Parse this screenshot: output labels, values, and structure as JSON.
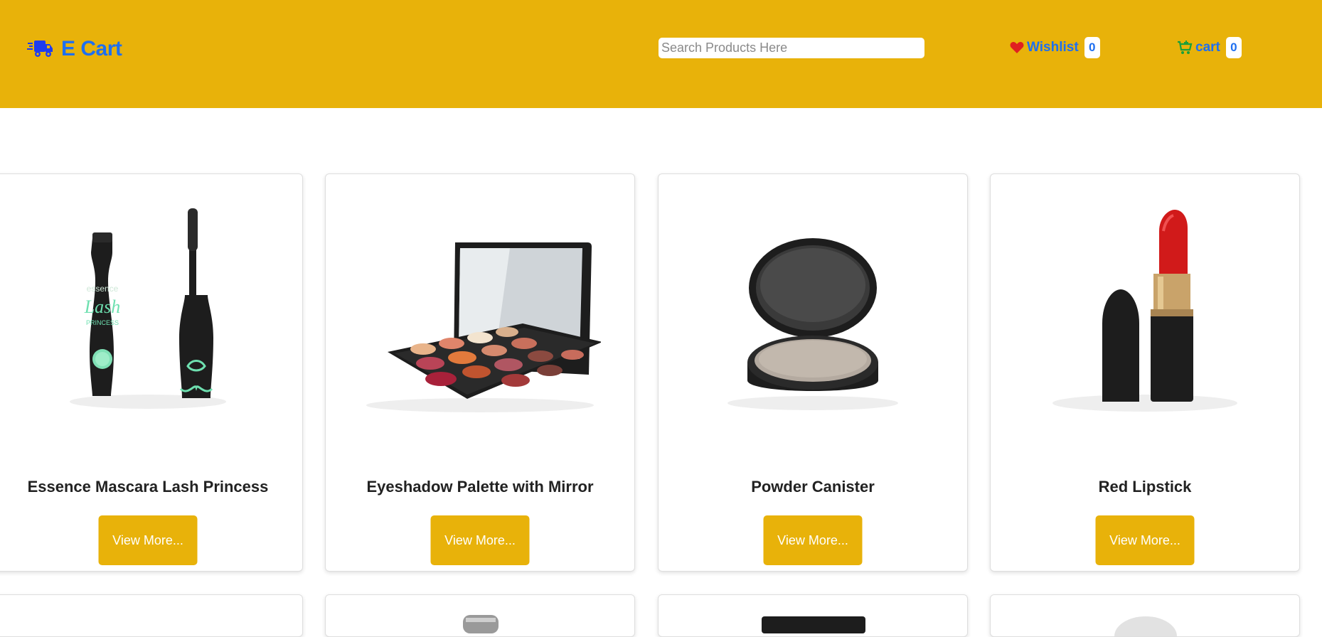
{
  "brand": {
    "name": "E Cart",
    "icon": "truck-icon",
    "color": "#1e6ff0"
  },
  "header": {
    "background": "#e8b20a"
  },
  "search": {
    "placeholder": "Search Products Here"
  },
  "nav": {
    "wishlist": {
      "label": "Wishlist",
      "count": "0",
      "icon": "heart-icon",
      "icon_color": "#e02020"
    },
    "cart": {
      "label": "cart",
      "count": "0",
      "icon": "cart-icon",
      "icon_color": "#1a9f3a"
    }
  },
  "products": [
    {
      "title": "Essence Mascara Lash Princess",
      "button": "View More...",
      "image": "mascara"
    },
    {
      "title": "Eyeshadow Palette with Mirror",
      "button": "View More...",
      "image": "eyeshadow-palette"
    },
    {
      "title": "Powder Canister",
      "button": "View More...",
      "image": "powder-compact"
    },
    {
      "title": "Red Lipstick",
      "button": "View More...",
      "image": "lipstick"
    }
  ],
  "button_color": "#e8b20a"
}
